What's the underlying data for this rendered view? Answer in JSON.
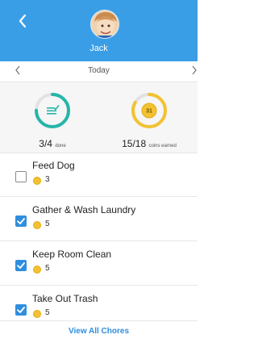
{
  "header": {
    "back_icon": "chevron-left-icon",
    "child_name": "Jack",
    "bg_color": "#3a9ee6"
  },
  "date_nav": {
    "prev_icon": "chevron-left-icon",
    "label": "Today",
    "next_icon": "chevron-right-icon"
  },
  "stats": {
    "done": {
      "count": "3/4",
      "label": "done",
      "progress": 0.75,
      "color": "#26b5a9"
    },
    "coins": {
      "count": "15/18",
      "label": "coins earned",
      "badge": "31",
      "progress": 0.8333,
      "color": "#f2c232"
    }
  },
  "chores": [
    {
      "name": "Feed Dog",
      "coins": "3",
      "checked": false
    },
    {
      "name": "Gather & Wash Laundry",
      "coins": "5",
      "checked": true
    },
    {
      "name": "Keep Room Clean",
      "coins": "5",
      "checked": true
    },
    {
      "name": "Take Out Trash",
      "coins": "5",
      "checked": true
    }
  ],
  "footer": {
    "view_all_label": "View All Chores",
    "accent": "#2f8fde"
  }
}
